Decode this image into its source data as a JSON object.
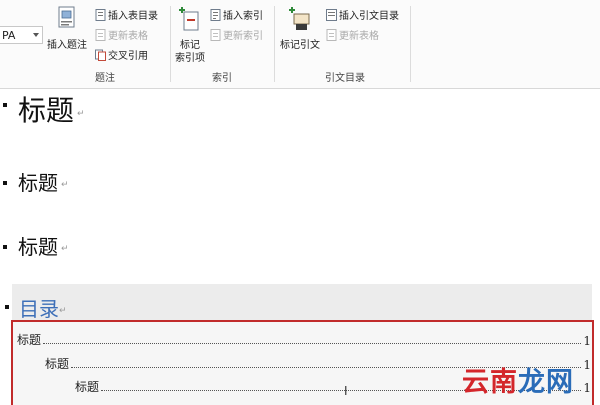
{
  "ribbon": {
    "style_value": "PA",
    "groups": {
      "captions": {
        "label": "题注",
        "insert_caption": "插入题注",
        "insert_table_of_figures": "插入表目录",
        "update_table": "更新表格",
        "cross_reference": "交叉引用"
      },
      "index": {
        "label": "索引",
        "mark_entry_line1": "标记",
        "mark_entry_line2": "索引项",
        "insert_index": "插入索引",
        "update_index": "更新索引"
      },
      "citations": {
        "label": "引文目录",
        "mark_citation": "标记引文",
        "insert_table_of_authorities": "插入引文目录",
        "update_table": "更新表格"
      }
    }
  },
  "document": {
    "headings": [
      "标题",
      "标题",
      "标题"
    ],
    "toc_title": "目录",
    "toc_entries": [
      {
        "text": "标题",
        "page": "1"
      },
      {
        "text": "标题",
        "page": "1"
      },
      {
        "text": "标题",
        "page": "1"
      }
    ]
  },
  "watermark": {
    "part1": "云南",
    "part2": "龙网"
  },
  "colors": {
    "toc_title": "#3d6fb8",
    "highlight_border": "#c12b2b",
    "watermark_red": "#d4262b",
    "watermark_blue": "#2a6cb8"
  }
}
